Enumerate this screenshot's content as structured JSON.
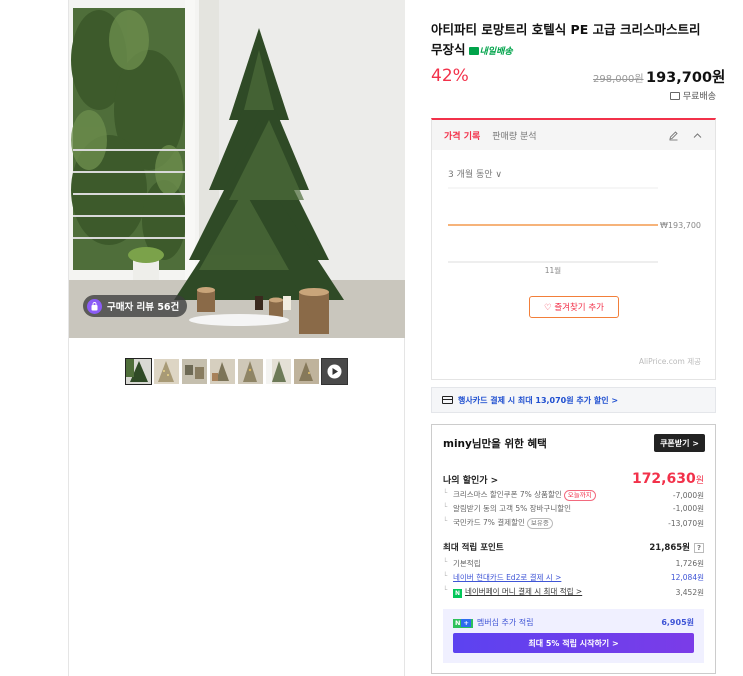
{
  "product": {
    "title": "아티파티 로망트리 호텔식 PE 고급 크리스마스트리 무장식",
    "arrival_badge": "내일배송",
    "discount": "42%",
    "original_price": "298,000원",
    "sale_price": "193,700원",
    "shipping": "무료배송"
  },
  "gallery": {
    "review_pill": "구매자 리뷰 56건",
    "thumbnail_count": 8,
    "active_thumbnail": 1,
    "last_thumbnail_is_video": true
  },
  "price_history": {
    "tab_active": "가격 기록",
    "tab_other": "판매량 분석",
    "period": "3 개월 동안 ∨",
    "price_label": "₩193,700",
    "month_label": "11월",
    "favorite_button": "♡ 즐겨찾기 추가",
    "credit": "AliPrice.com 제공"
  },
  "card_banner": {
    "text": "행사카드 결제 시 최대 13,070원 추가 할인 >"
  },
  "benefit": {
    "title": "miny님만을 위한 혜택",
    "coupon_button": "쿠폰받기 >",
    "my_price_label": "나의 할인가 >",
    "my_price_value": "172,630",
    "my_price_unit": "원",
    "discounts": [
      {
        "label": "크리스마스 할인쿠폰 7% 상품할인",
        "tag": "오늘까지",
        "value": "-7,000원"
      },
      {
        "label": "알림받기 동의 고객 5% 장바구니할인",
        "tag": "",
        "value": "-1,000원"
      },
      {
        "label": "국민카드 7% 결제할인",
        "tag": "보유중",
        "value": "-13,070원"
      }
    ],
    "points_label": "최대 적립 포인트",
    "points_value": "21,865원",
    "points_help": "?",
    "points": [
      {
        "label": "기본적립",
        "value": "1,726원"
      },
      {
        "label": "네이버 현대카드 Ed2로 결제 시 >",
        "value": "12,084원"
      },
      {
        "label": "네이버페이 머니 결제 시 최대 적립 >",
        "value": "3,452원"
      }
    ],
    "member_label": "멤버십 추가 적립",
    "member_value": "6,905원",
    "member_button": "최대 5% 적립 시작하기 >"
  },
  "colors": {
    "accent_red": "#f2314a",
    "link_blue": "#3f55d6",
    "naver_green": "#03c75a",
    "member_purple": "#5c42f0"
  }
}
